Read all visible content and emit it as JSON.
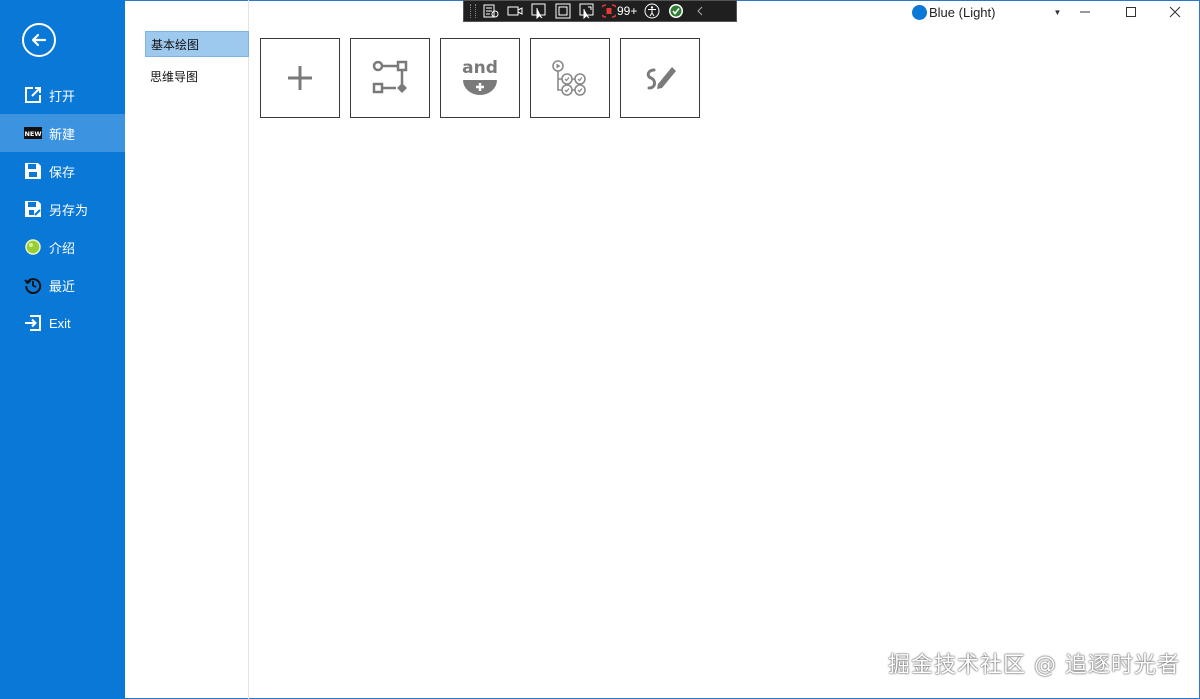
{
  "sidebar": {
    "back_icon": "back-arrow-circle-icon",
    "items": [
      {
        "label": "打开",
        "icon": "open-external-icon"
      },
      {
        "label": "新建",
        "icon": "new-badge-icon",
        "badge_text": "NEW"
      },
      {
        "label": "保存",
        "icon": "save-icon"
      },
      {
        "label": "另存为",
        "icon": "save-as-icon"
      },
      {
        "label": "介绍",
        "icon": "info-ball-icon"
      },
      {
        "label": "最近",
        "icon": "history-icon"
      },
      {
        "label": "Exit",
        "icon": "exit-icon"
      }
    ],
    "active_index": 1
  },
  "categories": {
    "items": [
      {
        "label": "基本绘图"
      },
      {
        "label": "思维导图"
      }
    ],
    "active_index": 0
  },
  "templates": [
    {
      "icon": "plus-icon"
    },
    {
      "icon": "flowchart-icon"
    },
    {
      "icon": "logic-and-icon",
      "text": "and"
    },
    {
      "icon": "workflow-icon"
    },
    {
      "icon": "freehand-draw-icon"
    }
  ],
  "devbar": {
    "error_count": "99+"
  },
  "theme": {
    "label": "Blue (Light)",
    "color": "#0a78d6"
  },
  "watermark": "掘金技术社区 @ 追逐时光者",
  "colors": {
    "sidebar": "#0a78d6",
    "active_nav": "#3c93e0",
    "active_category": "#9ec9ee"
  }
}
